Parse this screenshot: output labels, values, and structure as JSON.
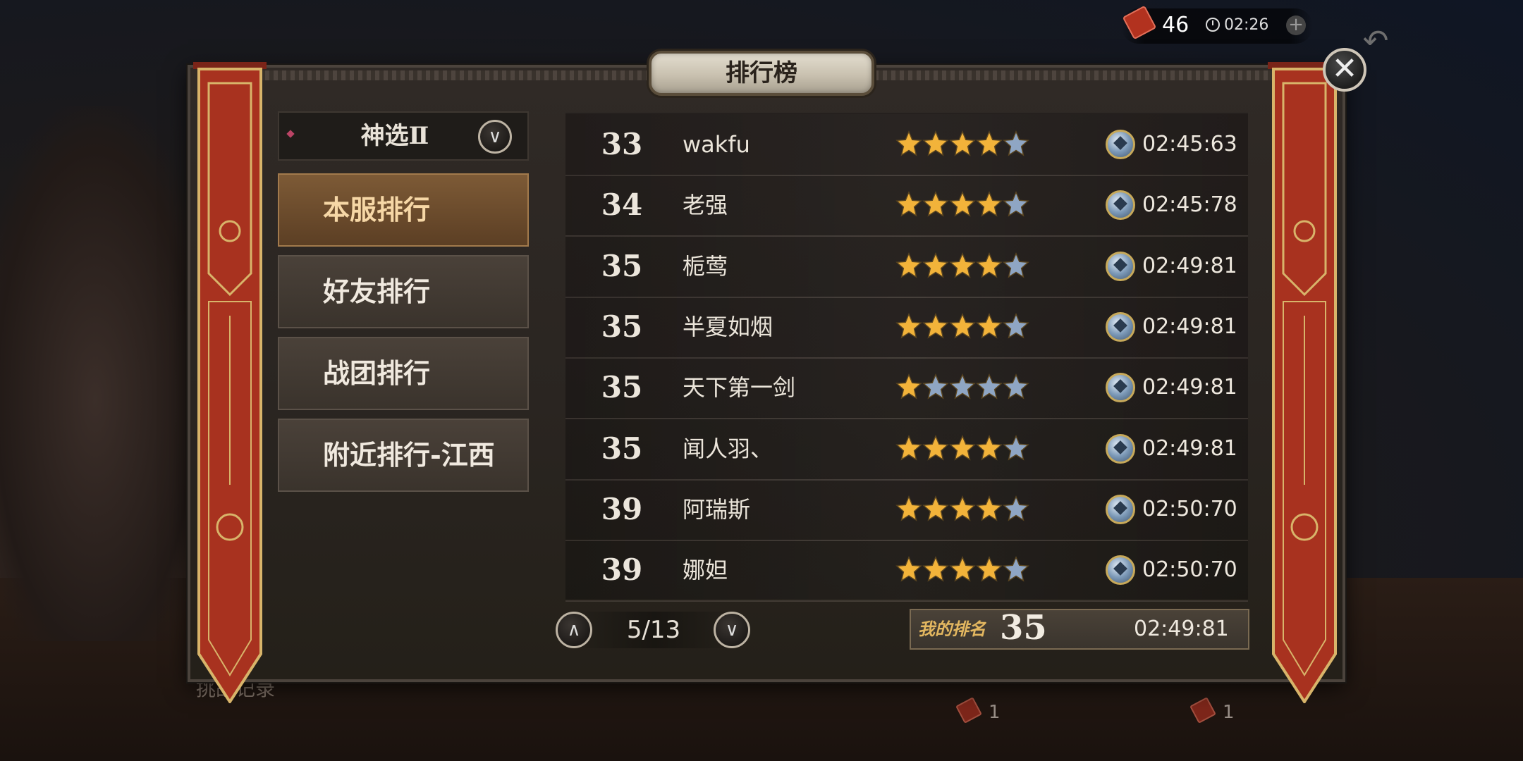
{
  "status_bar": {
    "ticket_icon": "ticket-icon",
    "ticket_count": "46",
    "clock_icon": "clock-icon",
    "timer": "02:26",
    "plus_label": "+",
    "back_icon": "back-arrow-icon"
  },
  "window": {
    "title": "排行榜",
    "close_icon": "close-icon"
  },
  "category": {
    "selected": "神选Ⅱ",
    "dropdown_icon": "chevron-down-icon"
  },
  "tabs": [
    {
      "label": "本服排行",
      "active": true
    },
    {
      "label": "好友排行",
      "active": false
    },
    {
      "label": "战团排行",
      "active": false
    },
    {
      "label": "附近排行-江西",
      "active": false
    }
  ],
  "rows": [
    {
      "rank": "33",
      "name": "wakfu",
      "stars": 4,
      "max_stars": 5,
      "time": "02:45:63"
    },
    {
      "rank": "34",
      "name": "老强",
      "stars": 4,
      "max_stars": 5,
      "time": "02:45:78"
    },
    {
      "rank": "35",
      "name": "栀莺",
      "stars": 4,
      "max_stars": 5,
      "time": "02:49:81"
    },
    {
      "rank": "35",
      "name": "半夏如烟",
      "stars": 4,
      "max_stars": 5,
      "time": "02:49:81"
    },
    {
      "rank": "35",
      "name": "天下第一剑",
      "stars": 1,
      "max_stars": 5,
      "time": "02:49:81"
    },
    {
      "rank": "35",
      "name": "闻人羽、",
      "stars": 4,
      "max_stars": 5,
      "time": "02:49:81"
    },
    {
      "rank": "39",
      "name": "阿瑞斯",
      "stars": 4,
      "max_stars": 5,
      "time": "02:50:70"
    },
    {
      "rank": "39",
      "name": "娜妲",
      "stars": 4,
      "max_stars": 5,
      "time": "02:50:70"
    }
  ],
  "pager": {
    "label": "5/13",
    "up_icon": "chevron-up-icon",
    "down_icon": "chevron-down-icon"
  },
  "my_rank": {
    "label": "我的排名",
    "rank": "35",
    "time": "02:49:81"
  },
  "background": {
    "partial_text": "挑战记录",
    "slot_count_left": "1",
    "slot_count_right": "1"
  },
  "colors": {
    "gold_star": "#f2b33a",
    "silver_star": "#8fa6c4",
    "active_tab": "#7d5a36",
    "banner_red": "#a8321f"
  }
}
